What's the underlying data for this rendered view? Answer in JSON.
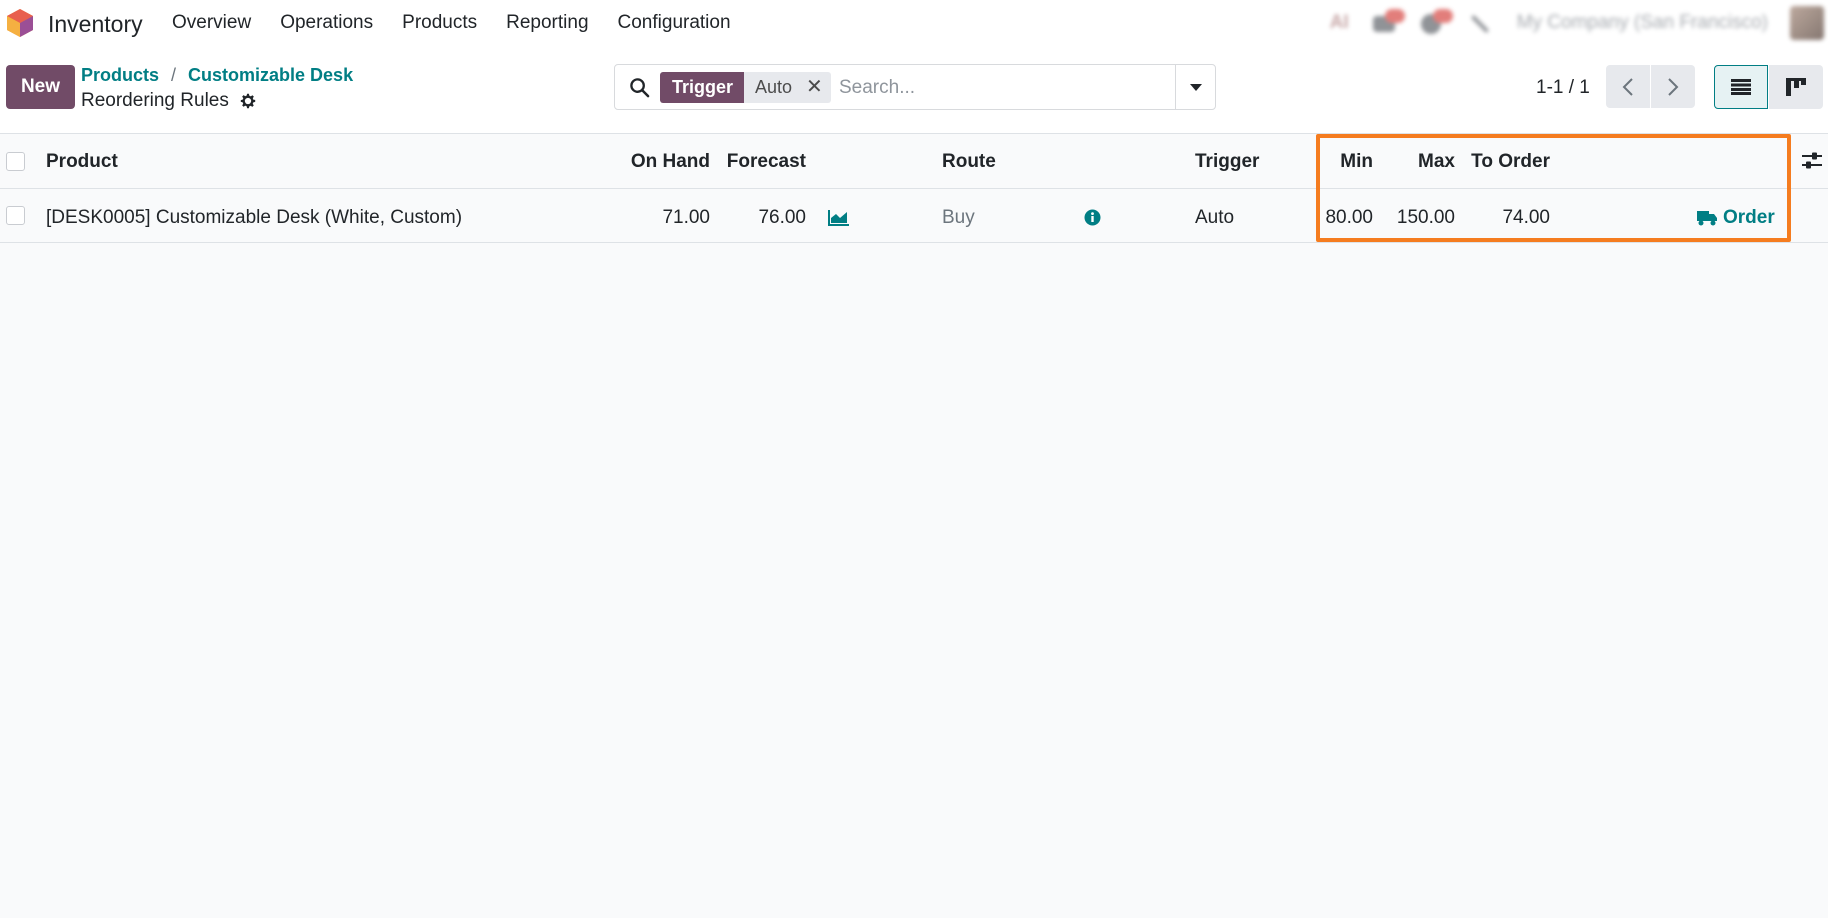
{
  "navbar": {
    "app_name": "Inventory",
    "menu": [
      "Overview",
      "Operations",
      "Products",
      "Reporting",
      "Configuration"
    ],
    "systray": {
      "ai_label": "AI",
      "company": "My Company (San Francisco)"
    }
  },
  "control_panel": {
    "new_label": "New",
    "breadcrumb": [
      "Products",
      "Customizable Desk"
    ],
    "breadcrumb_sep": "/",
    "view_title": "Reordering Rules",
    "search": {
      "facet_label": "Trigger",
      "facet_value": "Auto",
      "placeholder": "Search..."
    },
    "pager": "1-1 / 1"
  },
  "list": {
    "columns": {
      "product": "Product",
      "on_hand": "On Hand",
      "forecast": "Forecast",
      "route": "Route",
      "trigger": "Trigger",
      "min": "Min",
      "max": "Max",
      "to_order": "To Order"
    },
    "rows": [
      {
        "product": "[DESK0005] Customizable Desk (White, Custom)",
        "on_hand": "71.00",
        "forecast": "76.00",
        "route": "Buy",
        "trigger": "Auto",
        "min": "80.00",
        "max": "150.00",
        "to_order": "74.00",
        "action": "Order"
      }
    ]
  },
  "colors": {
    "primary": "#714b67",
    "link": "#017e84",
    "highlight": "#f57c1f"
  },
  "icons": {
    "logo": "odoo-inventory-logo-icon",
    "search": "search-icon",
    "forecast": "area-chart-icon",
    "route_info": "info-circle-icon",
    "order": "truck-icon",
    "settings": "sliders-icon",
    "list_view": "list-icon",
    "kanban_view": "kanban-icon"
  }
}
